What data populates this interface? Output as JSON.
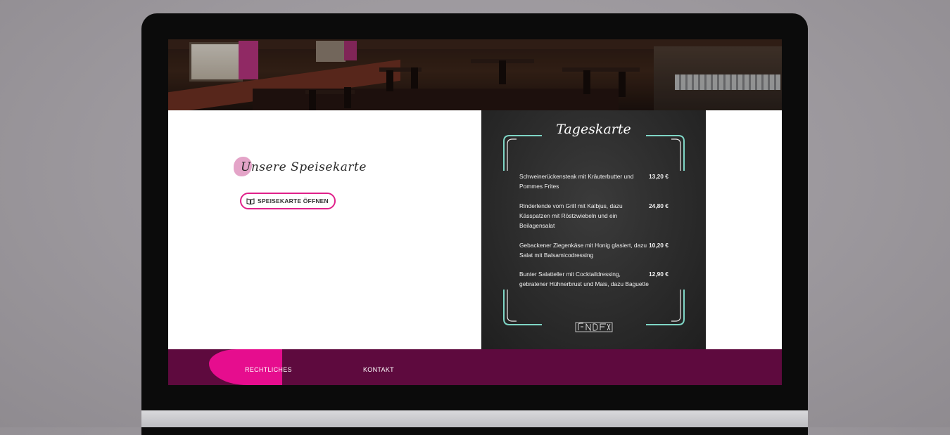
{
  "menu_section": {
    "title": "Unsere Speisekarte",
    "open_button_label": "SPEISEKARTE ÖFFNEN"
  },
  "daily_menu": {
    "title": "Tageskarte",
    "items": [
      {
        "name": "Schweinerückensteak mit Kräuterbutter und Pommes Frites",
        "price": "13,20 €"
      },
      {
        "name": "Rinderlende vom Grill mit Kalbjus, dazu Kässpatzen mit Röstzwiebeln und ein Beilagensalat",
        "price": "24,80 €"
      },
      {
        "name": "Gebackener Ziegenkäse mit Honig glasiert, dazu Salat mit Balsamicodressing",
        "price": "10,20 €"
      },
      {
        "name": "Bunter Salatteller mit Cocktaildressing, gebratener Hühnerbrust und Mais, dazu Baguette",
        "price": "12,90 €"
      }
    ],
    "frame_color": "#7fd6c6"
  },
  "footer": {
    "links": [
      "RECHTLICHES",
      "KONTAKT"
    ],
    "background_color": "#5e0a3e",
    "accent_color": "#e60d8e"
  },
  "icons": {
    "book": "book-open-icon"
  }
}
